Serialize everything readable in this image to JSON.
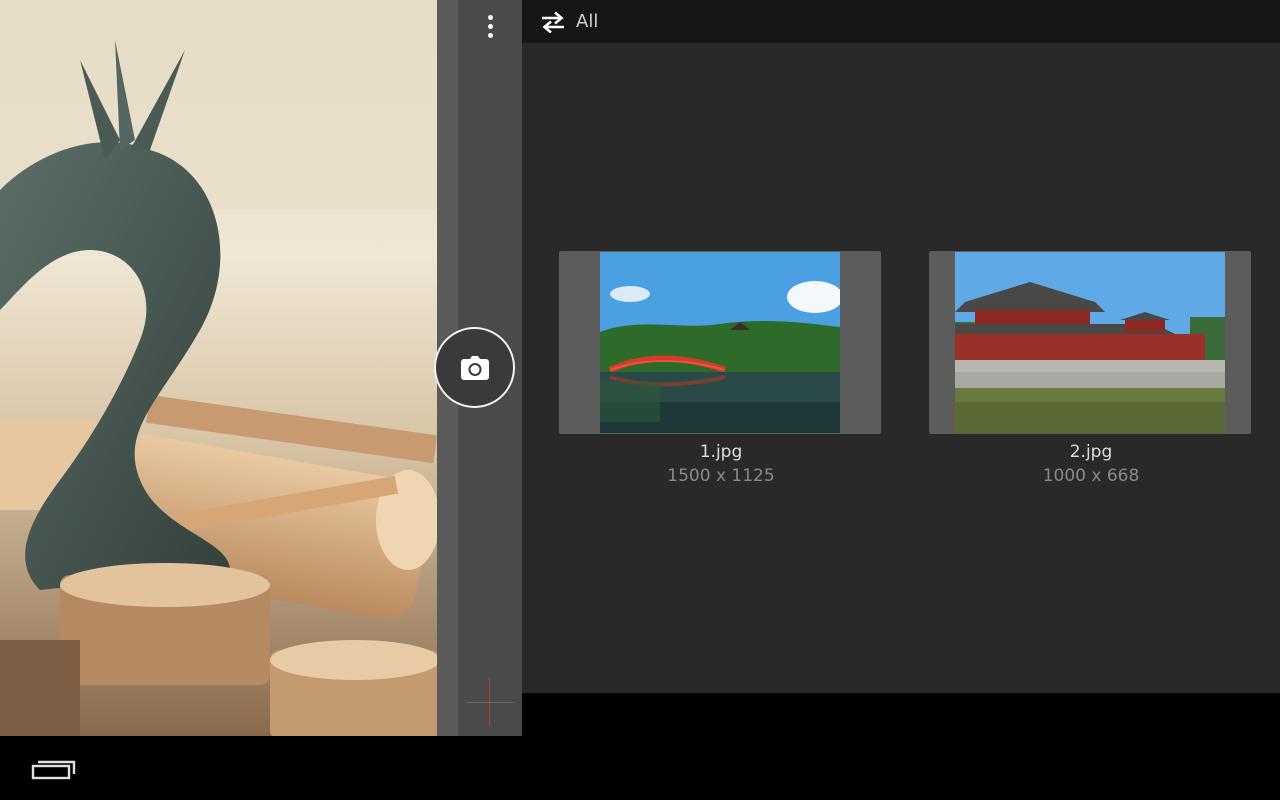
{
  "topbar": {
    "filter_label": "All",
    "filter_icon": "swap-arrows-icon"
  },
  "toolbar": {
    "more_icon": "overflow-menu-icon",
    "camera_icon": "camera-icon"
  },
  "viewer": {
    "subject": "dragon statue fountain"
  },
  "gallery": {
    "items": [
      {
        "name": "1.jpg",
        "dims": "1500 x 1125"
      },
      {
        "name": "2.jpg",
        "dims": "1000 x 668"
      }
    ]
  },
  "navbar": {
    "recent_icon": "recent-apps-icon"
  },
  "colors": {
    "topbar": "#161616",
    "panel": "#292929",
    "strip": "#4a4a4a",
    "accent": "#c0392b"
  }
}
